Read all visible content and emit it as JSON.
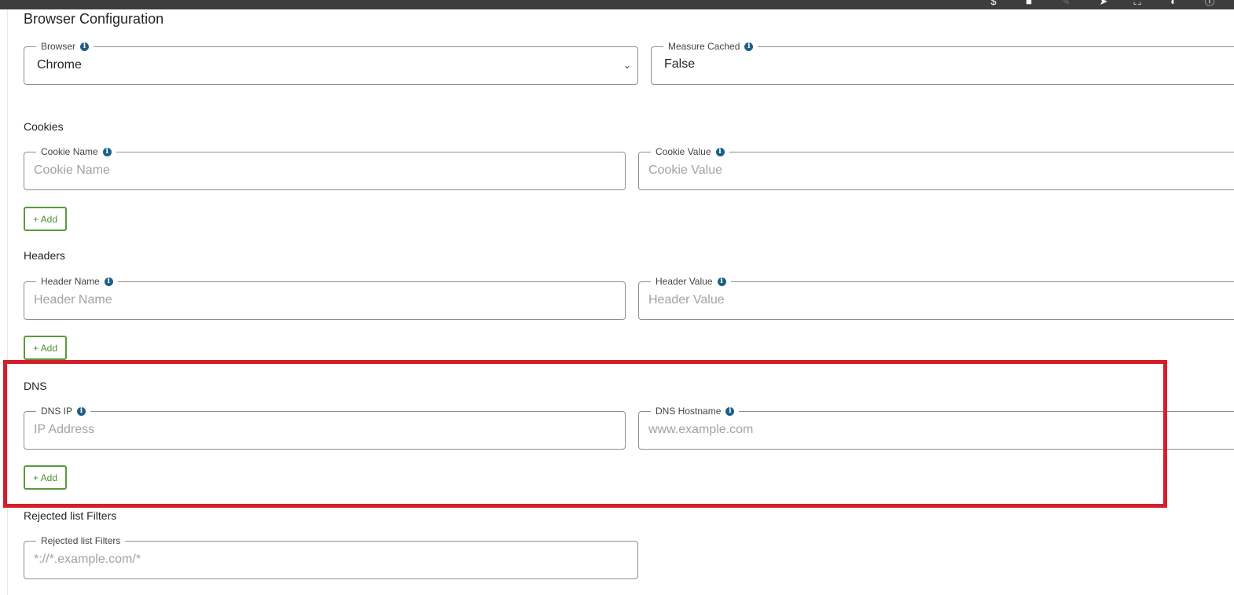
{
  "toolbar": {
    "icons": [
      "dollar-icon",
      "comment-icon",
      "pen-icon",
      "bolt-icon",
      "fullscreen-icon",
      "contrast-icon",
      "help-icon"
    ]
  },
  "page": {
    "title": "Browser Configuration"
  },
  "browser": {
    "browser_label": "Browser",
    "browser_value": "Chrome",
    "measure_cached_label": "Measure Cached",
    "measure_cached_value": "False"
  },
  "cookies": {
    "title": "Cookies",
    "name_label": "Cookie Name",
    "name_placeholder": "Cookie Name",
    "value_label": "Cookie Value",
    "value_placeholder": "Cookie Value",
    "add_label": "+ Add"
  },
  "headers": {
    "title": "Headers",
    "name_label": "Header Name",
    "name_placeholder": "Header Name",
    "value_label": "Header Value",
    "value_placeholder": "Header Value",
    "add_label": "+ Add"
  },
  "dns": {
    "title": "DNS",
    "ip_label": "DNS IP",
    "ip_placeholder": "IP Address",
    "hostname_label": "DNS Hostname",
    "hostname_placeholder": "www.example.com",
    "add_label": "+ Add"
  },
  "rejected": {
    "title": "Rejected list Filters",
    "label": "Rejected list Filters",
    "placeholder": "*://*.example.com/*"
  },
  "colors": {
    "highlight": "#d41e2a",
    "add_button": "#5a9a3d",
    "info_icon": "#1d5f8a"
  }
}
